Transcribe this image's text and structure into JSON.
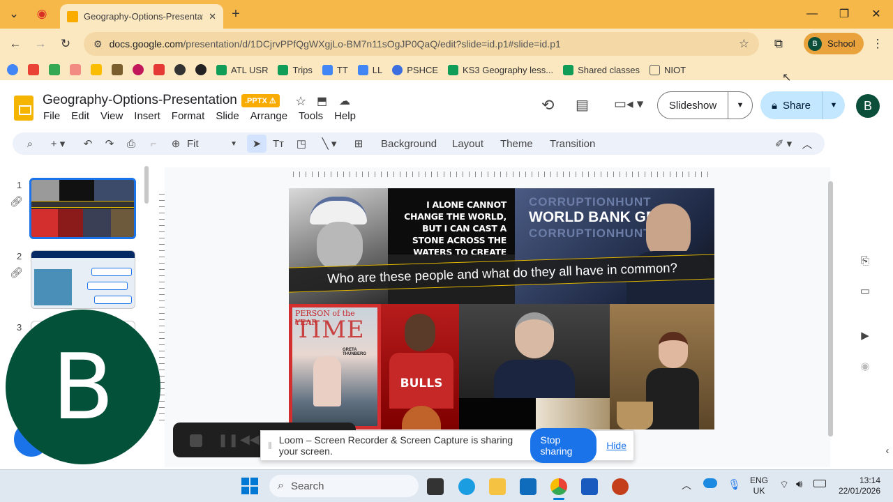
{
  "browser": {
    "tab_title": "Geography-Options-Presentatio",
    "url_host": "docs.google.com",
    "url_path": "/presentation/d/1DCjrvPPfQgWXgjLo-BM7n11sOgJP0QaQ/edit?slide=id.p1#slide=id.p1",
    "profile_initial": "B",
    "profile_label": "School"
  },
  "bookmarks": [
    "ATL USR",
    "Trips",
    "TT",
    "LL",
    "PSHCE",
    "KS3 Geography less...",
    "Shared classes",
    "NIOT"
  ],
  "slides_app": {
    "title": "Geography-Options-Presentation",
    "badge": ".PPTX",
    "menu": [
      "File",
      "Edit",
      "View",
      "Insert",
      "Format",
      "Slide",
      "Arrange",
      "Tools",
      "Help"
    ],
    "slideshow_label": "Slideshow",
    "share_label": "Share",
    "user_initial": "B",
    "zoom": "Fit",
    "toolbar_text": [
      "Background",
      "Layout",
      "Theme",
      "Transition"
    ]
  },
  "filmstrip": {
    "slide_numbers": [
      "1",
      "2",
      "3"
    ]
  },
  "slide": {
    "quote": "I ALONE CANNOT CHANGE THE WORLD, BUT I CAN CAST A STONE ACROSS THE WATERS TO CREATE MANY RIPPLES.",
    "banner_text": "WORLD BANK GR",
    "watermark": "CORRUPTIONHUNT",
    "question": "Who are these people and what do they all have in common?",
    "time_header": "PERSON of the YEAR",
    "time_logo": "TIME",
    "time_name": "GRETA THUNBERG",
    "jersey": "BULLS"
  },
  "overlay": {
    "big_initial": "B"
  },
  "loom": {
    "message": "Loom – Screen Recorder & Screen Capture is sharing your screen.",
    "stop_label": "Stop sharing",
    "hide_label": "Hide"
  },
  "taskbar": {
    "search_label": "Search",
    "lang_top": "ENG",
    "lang_bottom": "UK",
    "time": "13:14",
    "date": "22/01/2026"
  },
  "colors": {
    "tab_strip": "#f7b84a",
    "slides_yellow": "#f4b400",
    "share_blue": "#c2e7ff",
    "loom_blue": "#1a73e8",
    "avatar_green": "#04513a"
  }
}
